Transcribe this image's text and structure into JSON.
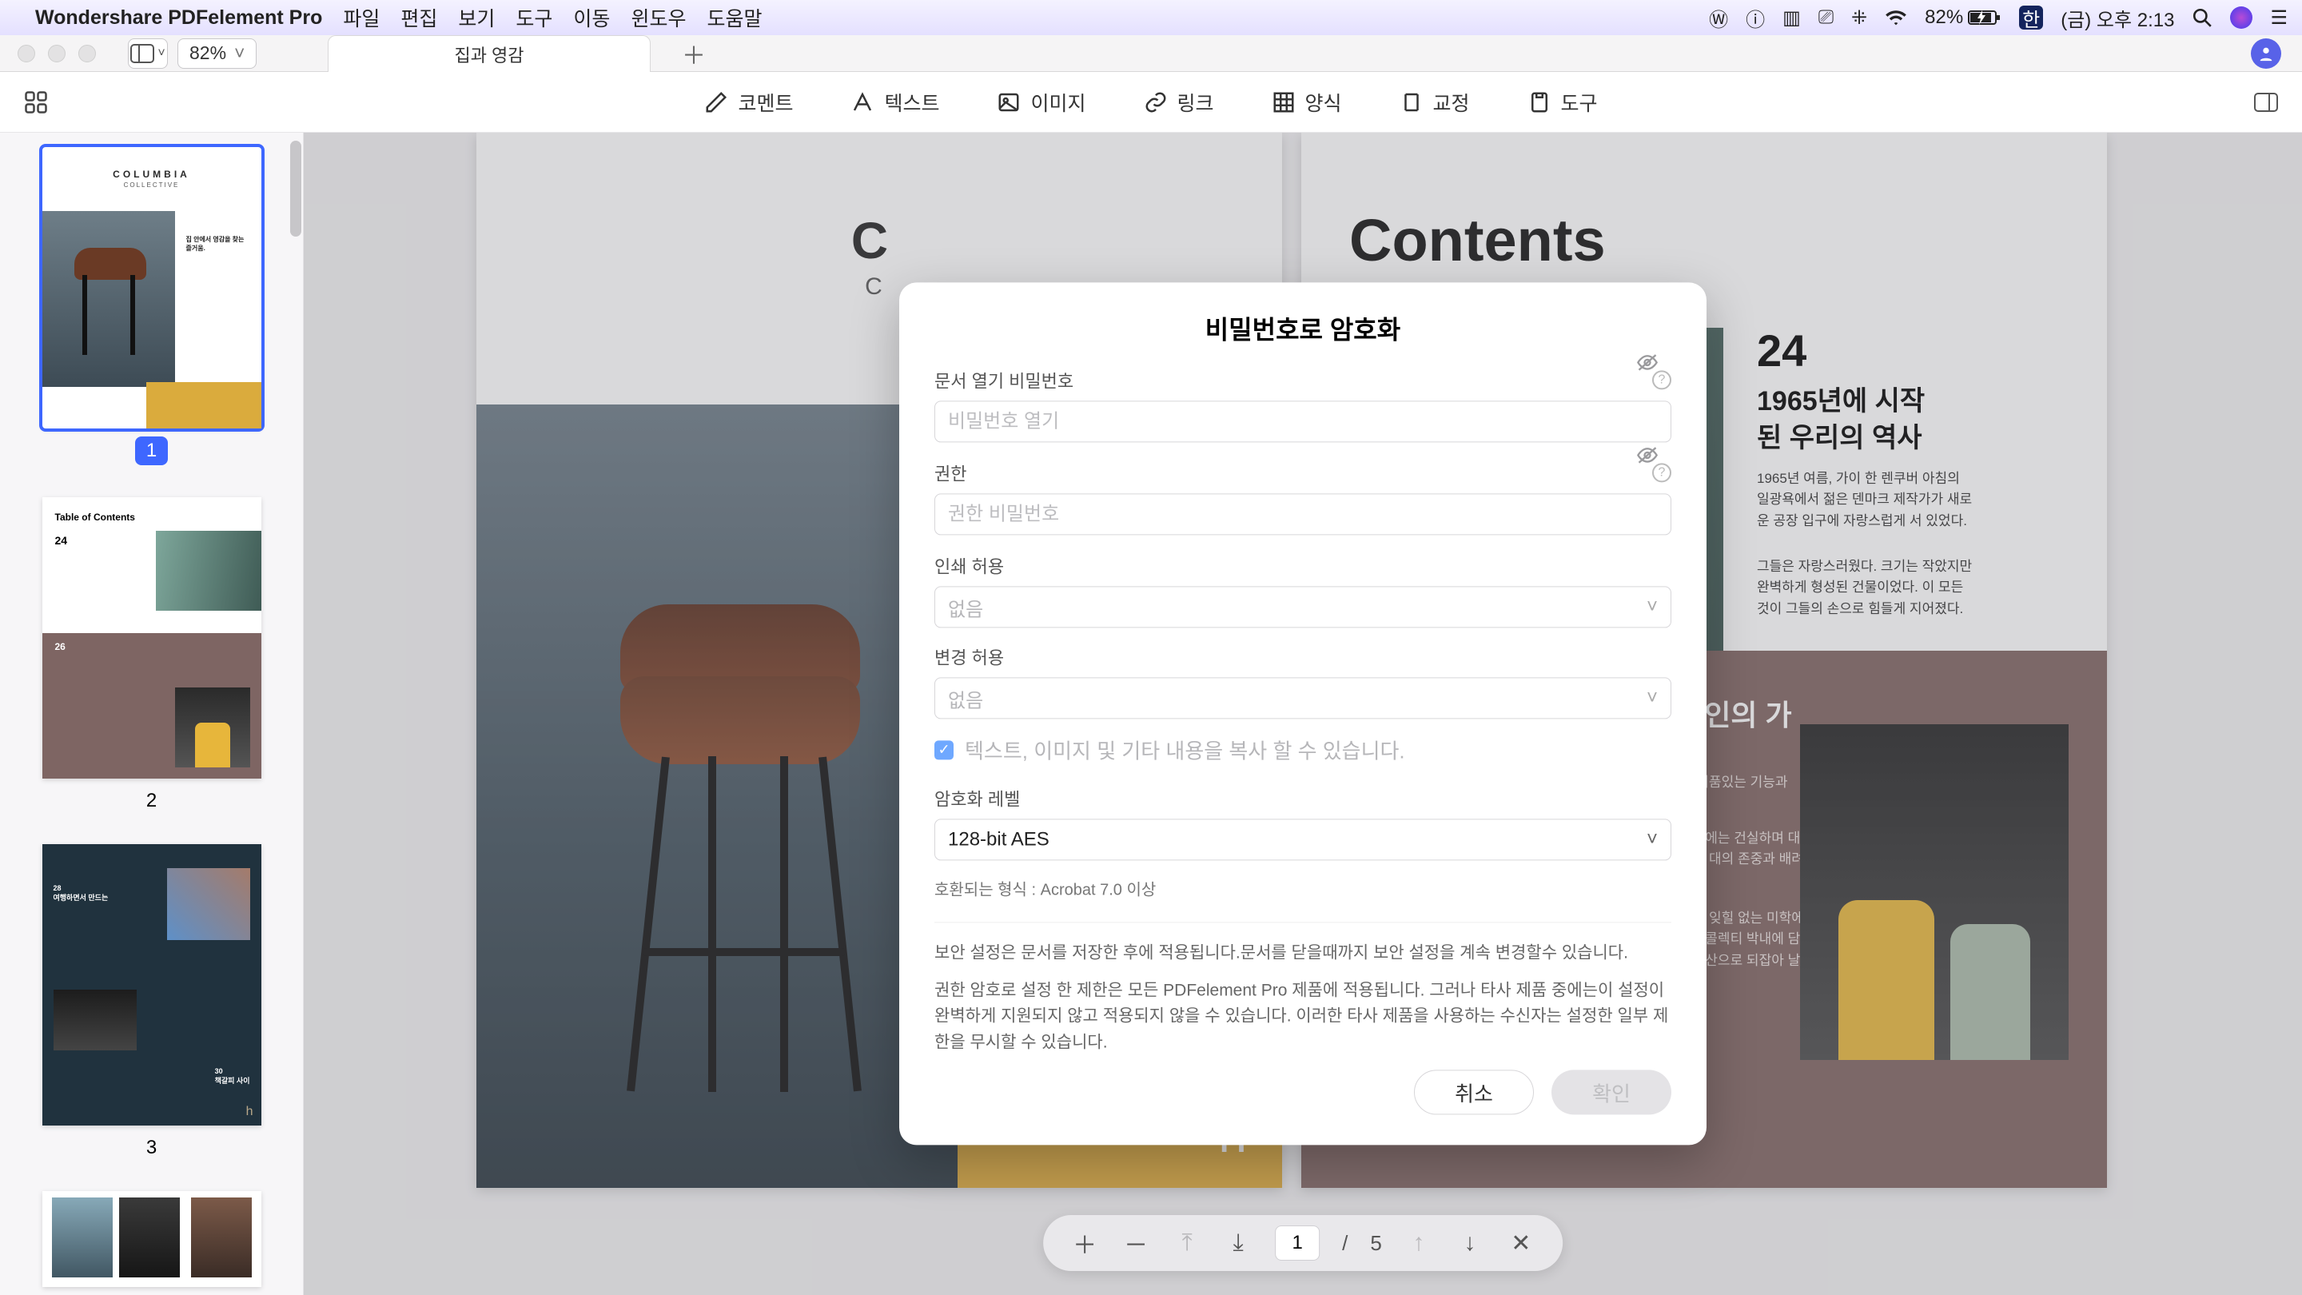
{
  "menubar": {
    "app": "Wondershare PDFelement Pro",
    "items": [
      "파일",
      "편집",
      "보기",
      "도구",
      "이동",
      "윈도우",
      "도움말"
    ],
    "battery": "82%",
    "input_lang": "한",
    "datetime": "(금) 오후 2:13"
  },
  "window": {
    "tab_title": "집과 영감",
    "zoom": "82%"
  },
  "toolbar": {
    "comment": "코멘트",
    "text": "텍스트",
    "image": "이미지",
    "link": "링크",
    "form": "양식",
    "proof": "교정",
    "tool": "도구"
  },
  "thumbs": {
    "n1": "1",
    "n2": "2",
    "n3": "3"
  },
  "page1": {
    "brand": "C O L U M B I A",
    "sub": "C O L L E C T I V E"
  },
  "page2": {
    "toc": "Contents",
    "num": "24",
    "h1a": "1965년에 시작",
    "h1b": "된 우리의 역사",
    "p1": "1965년 여름, 가이 한 렌쿠버 아침의 일광욕에서 젊은 덴마크 제작가가 새로운 공장 입구에 자랑스럽게 서 있었다.",
    "p2": "그들은 자랑스러웠다. 크기는 작았지만 완벽하게 형성된 건물이었다. 이 모든 것이 그들의 손으로 힘들게 지어졌다.",
    "num2": "26",
    "h2": "디자인의 가",
    "b1": "인정신. 기품있는 기능과",
    "b2": "인의 핵심에는 건실하며 대박내에 담겨진 미학에 대의 존중과 배려가 일종의",
    "b3": "는 주의의 잊힐 없는 미학에 만된 용은 컬럼비아 콜렉티 박내에 담겨진 모든 디자인의 생산으로 되잡아 날곱 수 있다."
  },
  "modal": {
    "title": "비밀번호로 암호화",
    "open_label": "문서 열기 비밀번호",
    "open_ph": "비밀번호 열기",
    "perm_label": "권한",
    "perm_ph": "권한 비밀번호",
    "print_label": "인쇄 허용",
    "print_val": "없음",
    "change_label": "변경 허용",
    "change_val": "없음",
    "copy_chk": "텍스트, 이미지 및 기타 내용을 복사 할 수 있습니다.",
    "level_label": "암호화 레벨",
    "level_val": "128-bit AES",
    "compat": "호환되는 형식 : Acrobat 7.0 이상",
    "note1": "보안 설정은 문서를 저장한 후에 적용됩니다.문서를 닫을때까지 보안 설정을 계속 변경할수 있습니다.",
    "note2": "권한 암호로 설정 한 제한은 모든 PDFelement Pro 제품에 적용됩니다. 그러나 타사 제품 중에는이 설정이 완벽하게 지원되지 않고 적용되지 않을 수 있습니다. 이러한 타사 제품을 사용하는 수신자는 설정한 일부 제한을 무시할 수 있습니다.",
    "cancel": "취소",
    "ok": "확인"
  },
  "pager": {
    "current": "1",
    "total": "5",
    "sep": "/"
  }
}
